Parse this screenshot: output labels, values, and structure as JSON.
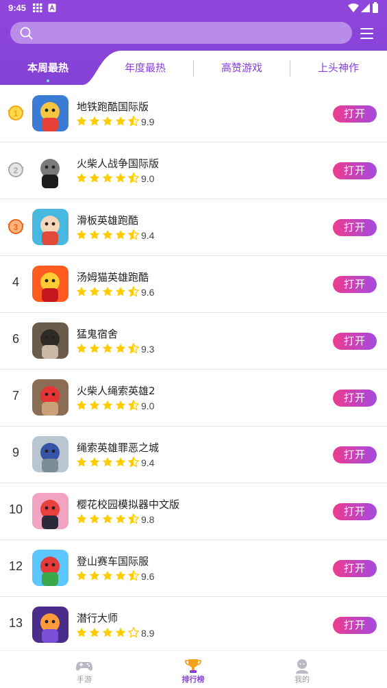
{
  "status_bar": {
    "time": "9:45"
  },
  "search": {
    "placeholder": ""
  },
  "tabs": [
    {
      "label": "本周最热",
      "active": true
    },
    {
      "label": "年度最热",
      "active": false
    },
    {
      "label": "高赞游戏",
      "active": false
    },
    {
      "label": "上头神作",
      "active": false
    }
  ],
  "open_label": "打开",
  "games": [
    {
      "rank": "1",
      "medal": "gold",
      "name": "地铁跑酷国际版",
      "stars": 4.5,
      "score": "9.9",
      "icon": "subway-surfers-icon"
    },
    {
      "rank": "2",
      "medal": "silver",
      "name": "火柴人战争国际版",
      "stars": 4.5,
      "score": "9.0",
      "icon": "stick-war-icon"
    },
    {
      "rank": "3",
      "medal": "bronze",
      "name": "滑板英雄跑酷",
      "stars": 4.5,
      "score": "9.4",
      "icon": "skate-hero-icon"
    },
    {
      "rank": "4",
      "medal": "",
      "name": "汤姆猫英雄跑酷",
      "stars": 4.5,
      "score": "9.6",
      "icon": "tom-hero-icon"
    },
    {
      "rank": "6",
      "medal": "",
      "name": "猛鬼宿舍",
      "stars": 4.5,
      "score": "9.3",
      "icon": "haunted-dorm-icon"
    },
    {
      "rank": "7",
      "medal": "",
      "name": "火柴人绳索英雄2",
      "stars": 4.5,
      "score": "9.0",
      "icon": "rope-hero-2-icon"
    },
    {
      "rank": "9",
      "medal": "",
      "name": "绳索英雄罪恶之城",
      "stars": 4.5,
      "score": "9.4",
      "icon": "rope-hero-vice-icon"
    },
    {
      "rank": "10",
      "medal": "",
      "name": "樱花校园模拟器中文版",
      "stars": 4.5,
      "score": "9.8",
      "icon": "sakura-school-icon"
    },
    {
      "rank": "12",
      "medal": "",
      "name": "登山赛车国际服",
      "stars": 4.5,
      "score": "9.6",
      "icon": "hill-climb-icon"
    },
    {
      "rank": "13",
      "medal": "",
      "name": "潜行大师",
      "stars": 4,
      "score": "8.9",
      "icon": "stealth-master-icon"
    }
  ],
  "bottom_nav": [
    {
      "label": "手游",
      "icon": "gamepad-icon",
      "active": false
    },
    {
      "label": "排行榜",
      "icon": "trophy-icon",
      "active": true
    },
    {
      "label": "我的",
      "icon": "profile-icon",
      "active": false
    }
  ],
  "colors": {
    "header": "#8f46dc",
    "accent": "#8a3fdb",
    "button_start": "#ec3c8e",
    "button_end": "#a54ae0",
    "star": "#ffcc00"
  }
}
